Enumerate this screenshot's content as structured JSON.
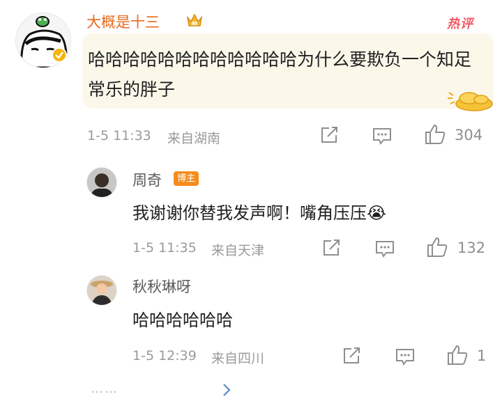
{
  "main_comment": {
    "username": "大概是十三",
    "hot_badge": "热评",
    "text": "哈哈哈哈哈哈哈哈哈哈哈哈为什么要欺负一个知足常乐的胖子",
    "date": "1-5 11:33",
    "location": "来自湖南",
    "like_count": "304",
    "icons": [
      "frog-crown-avatar",
      "crown-icon",
      "verified-icon",
      "coin-decoration",
      "share-icon",
      "comment-icon",
      "like-icon"
    ]
  },
  "replies": [
    {
      "username": "周奇",
      "badge": "博主",
      "text": "我谢谢你替我发声啊！嘴角压压😭",
      "date": "1-5 11:35",
      "location": "来自天津",
      "like_count": "132"
    },
    {
      "username": "秋秋琳呀",
      "text": "哈哈哈哈哈哈",
      "date": "1-5 12:39",
      "location": "来自四川",
      "like_count": "1"
    }
  ],
  "more_dots": "……",
  "colors": {
    "username_orange": "#e86a1f",
    "hot_red": "#f05a64",
    "blogger_badge": "#f58c1e",
    "bubble_bg": "#fbf8ea",
    "meta_gray": "#9a9a9a"
  }
}
